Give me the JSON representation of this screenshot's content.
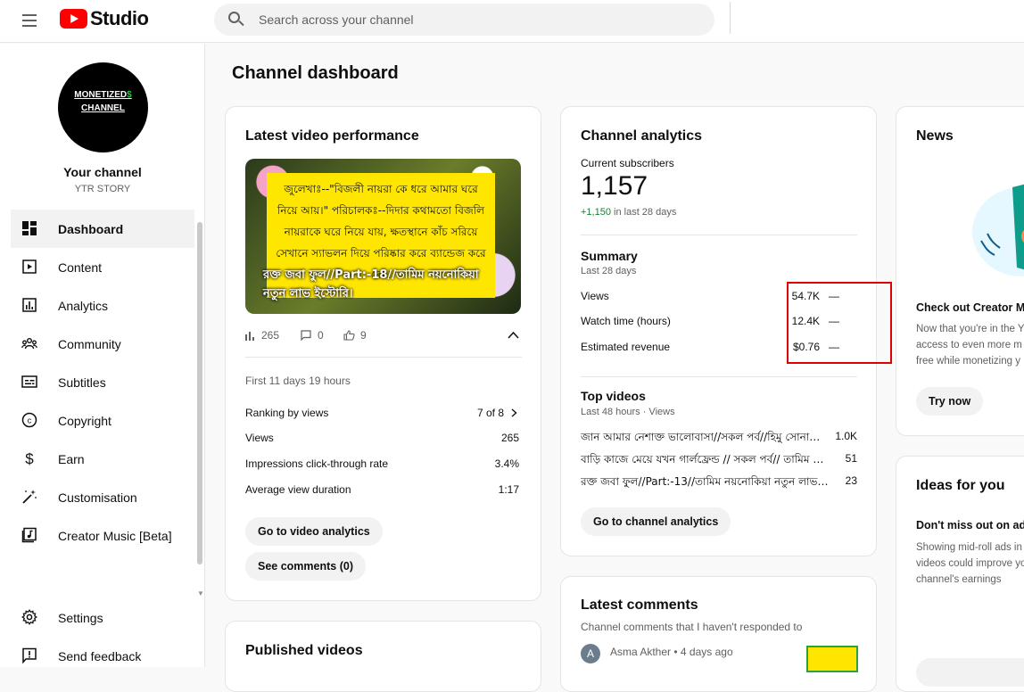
{
  "header": {
    "logo_text": "Studio",
    "search_placeholder": "Search across your channel"
  },
  "sidebar": {
    "avatar_line1": "MONETIZED",
    "avatar_dollar": "$",
    "avatar_line2": "CHANNEL",
    "channel_title": "Your channel",
    "channel_name": "YTR STORY",
    "items": [
      {
        "label": "Dashboard",
        "icon": "dashboard-icon",
        "active": true
      },
      {
        "label": "Content",
        "icon": "content-icon"
      },
      {
        "label": "Analytics",
        "icon": "analytics-icon"
      },
      {
        "label": "Community",
        "icon": "community-icon"
      },
      {
        "label": "Subtitles",
        "icon": "subtitles-icon"
      },
      {
        "label": "Copyright",
        "icon": "copyright-icon"
      },
      {
        "label": "Earn",
        "icon": "dollar-icon"
      },
      {
        "label": "Customisation",
        "icon": "magic-wand-icon"
      },
      {
        "label": "Creator Music [Beta]",
        "icon": "music-icon"
      }
    ],
    "bottom": [
      {
        "label": "Settings",
        "icon": "gear-icon"
      },
      {
        "label": "Send feedback",
        "icon": "feedback-icon"
      }
    ]
  },
  "page": {
    "title": "Channel dashboard"
  },
  "latest_video": {
    "title": "Latest video performance",
    "thumb_text": "জুলেখাঃ--\"বিজলী নায়রা কে ধরে আমার ঘরে নিয়ে আয়।\" পরিচালকঃ--দিদার কথামতো বিজলি নায়রাকে ঘরে নিয়ে যায়, ক্ষতস্থানে কাঁচ সরিয়ে সেখানে স্যাভলন দিয়ে পরিষ্কার করে ব্যান্ডেজ করে দেয়।",
    "thumb_caption": "রক্ত জবা ফুল//Part:-18//তামিম নয়নোকিয়া নতুন লাভ ইস্টোরি।",
    "views_count": "265",
    "comments_count": "0",
    "likes_count": "9",
    "period": "First 11 days 19 hours",
    "ranking_label": "Ranking by views",
    "ranking_value": "7 of 8",
    "rows": [
      {
        "label": "Views",
        "value": "265"
      },
      {
        "label": "Impressions click-through rate",
        "value": "3.4%"
      },
      {
        "label": "Average view duration",
        "value": "1:17"
      }
    ],
    "btn_analytics": "Go to video analytics",
    "btn_comments": "See comments (0)"
  },
  "published": {
    "title": "Published videos"
  },
  "channel_analytics": {
    "title": "Channel analytics",
    "subs_label": "Current subscribers",
    "subs_value": "1,157",
    "subs_delta": "+1,150",
    "subs_delta_suffix": " in last 28 days",
    "summary_title": "Summary",
    "summary_period": "Last 28 days",
    "metrics": [
      {
        "label": "Views",
        "value": "54.7K",
        "trend": "—"
      },
      {
        "label": "Watch time (hours)",
        "value": "12.4K",
        "trend": "—"
      },
      {
        "label": "Estimated revenue",
        "value": "$0.76",
        "trend": "—"
      }
    ],
    "top_title": "Top videos",
    "top_period": "Last 48 hours · Views",
    "top_videos": [
      {
        "title": "জান আমার নেশাক্ত ভালোবাসা//সকল পর্ব//হিমু সোনা…",
        "views": "1.0K"
      },
      {
        "title": "বাড়ি কাজে মেয়ে যখন গার্লফ্রেন্ড // সকল পর্ব// তামিম …",
        "views": "51"
      },
      {
        "title": "রক্ত জবা ফুল//Part:-13//তামিম নয়নোকিয়া নতুন লাভ …",
        "views": "23"
      }
    ],
    "btn": "Go to channel analytics"
  },
  "latest_comments": {
    "title": "Latest comments",
    "subtitle": "Channel comments that I haven't responded to",
    "author_initial": "A",
    "author": "Asma Akther",
    "time": " • 4 days ago"
  },
  "news": {
    "title": "News",
    "headline": "Check out Creator M",
    "body1": "Now that you're in the Y",
    "body2": "access to even more m",
    "body3": "free while monetizing y",
    "btn": "Try now"
  },
  "ideas": {
    "title": "Ideas for you",
    "headline": "Don't miss out on ad",
    "body1": "Showing mid-roll ads in",
    "body2": "videos could improve yo",
    "body3": "channel's earnings"
  }
}
